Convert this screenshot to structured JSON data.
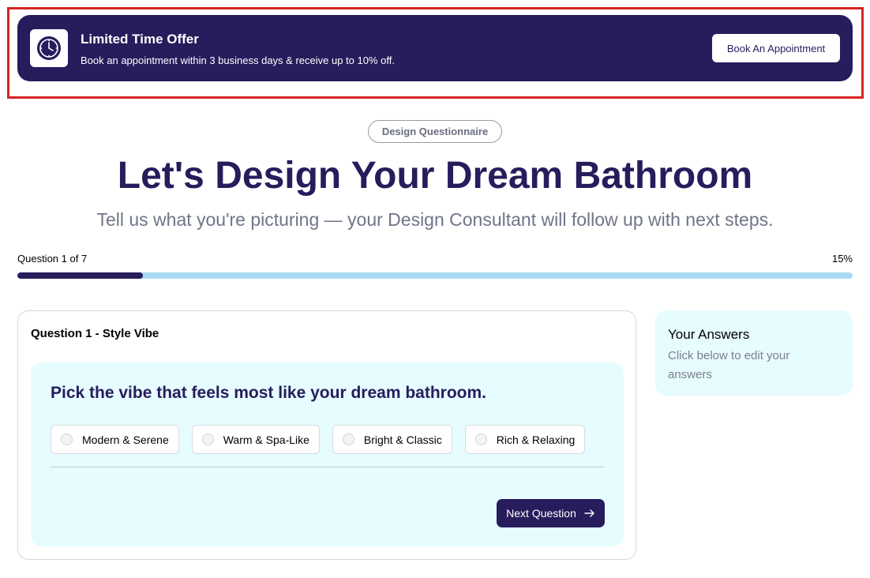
{
  "banner": {
    "title": "Limited Time Offer",
    "subtitle": "Book an appointment within 3 business days & receive up to 10% off.",
    "button_label": "Book An Appointment",
    "icon": "clock-icon",
    "bg_color": "#271c5c"
  },
  "hero": {
    "badge": "Design Questionnaire",
    "title": "Let's Design Your Dream Bathroom",
    "subtitle": "Tell us what you're picturing — your Design Consultant will follow up with next steps."
  },
  "progress": {
    "label": "Question 1 of 7",
    "percent_text": "15%",
    "percent": 15
  },
  "question": {
    "title": "Question 1 - Style Vibe",
    "prompt": "Pick the vibe that feels most like your dream bathroom.",
    "options": [
      {
        "label": "Modern & Serene",
        "selected": false
      },
      {
        "label": "Warm & Spa-Like",
        "selected": false
      },
      {
        "label": "Bright & Classic",
        "selected": false
      },
      {
        "label": "Rich & Relaxing",
        "selected": false
      }
    ],
    "next_label": "Next Question",
    "next_icon": "arrow-right-icon"
  },
  "answers": {
    "title": "Your Answers",
    "subtitle": "Click below to edit your answers"
  },
  "colors": {
    "brand": "#271c5c",
    "progress_track": "#a9d8f5",
    "panel_bg": "#e6fcfe",
    "highlight": "#d92323"
  }
}
